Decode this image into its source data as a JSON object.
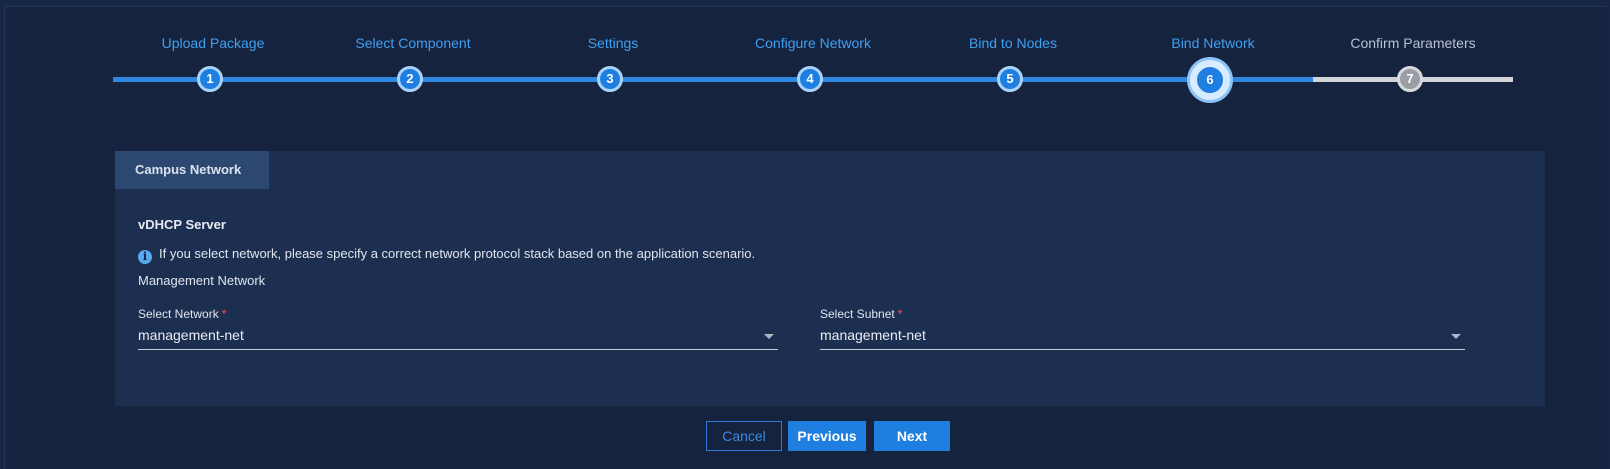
{
  "stepper": {
    "steps": [
      {
        "number": "1",
        "label": "Upload Package",
        "state": "done"
      },
      {
        "number": "2",
        "label": "Select Component",
        "state": "done"
      },
      {
        "number": "3",
        "label": "Settings",
        "state": "done"
      },
      {
        "number": "4",
        "label": "Configure Network",
        "state": "done"
      },
      {
        "number": "5",
        "label": "Bind to Nodes",
        "state": "done"
      },
      {
        "number": "6",
        "label": "Bind Network",
        "state": "current"
      },
      {
        "number": "7",
        "label": "Confirm Parameters",
        "state": "pending"
      }
    ]
  },
  "card": {
    "tab_label": "Campus Network",
    "section_title": "vDHCP Server",
    "info_icon": "info-icon",
    "info_text": "If you select network, please specify a correct network protocol stack based on the application scenario.",
    "subsection_title": "Management Network",
    "select_network": {
      "label": "Select Network",
      "required_mark": "*",
      "value": "management-net"
    },
    "select_subnet": {
      "label": "Select Subnet",
      "required_mark": "*",
      "value": "management-net"
    }
  },
  "actions": {
    "cancel_label": "Cancel",
    "previous_label": "Previous",
    "next_label": "Next"
  },
  "colors": {
    "accent": "#1f7fe0",
    "background": "#172644",
    "card": "#1d2f50",
    "pending": "#d2d4d8",
    "required": "#ff4d4f"
  }
}
